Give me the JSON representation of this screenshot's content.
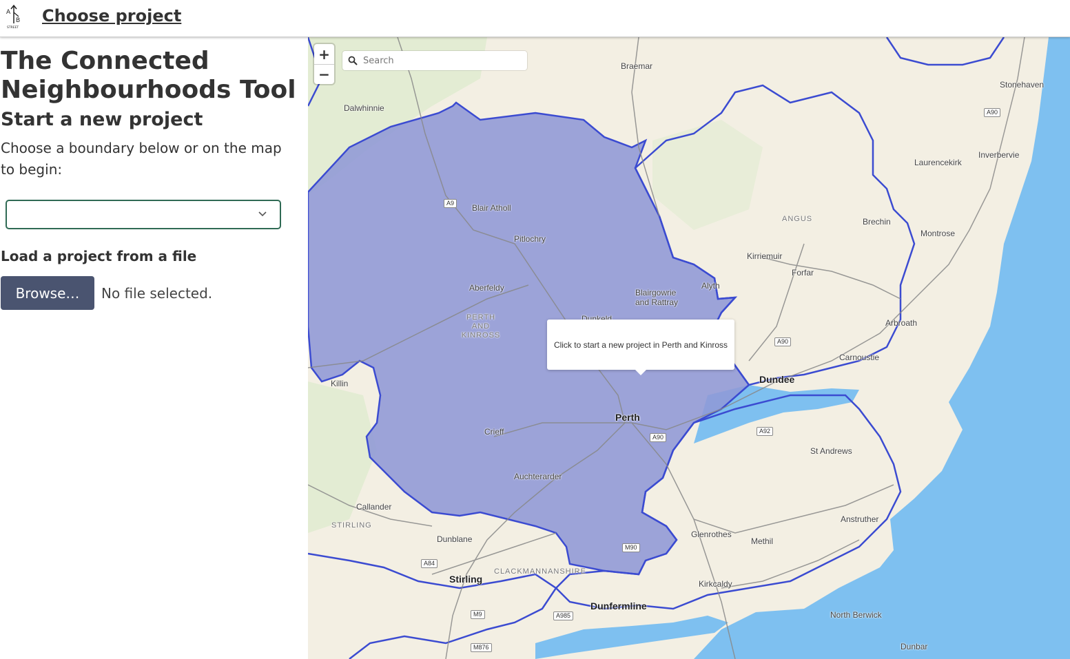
{
  "header": {
    "logo_alt": "A/B Street",
    "breadcrumb": "Choose project"
  },
  "sidebar": {
    "title": "The Connected Neighbourhoods Tool",
    "subtitle": "Start a new project",
    "instructions": "Choose a boundary below or on the map to begin:",
    "boundary_select": {
      "value": ""
    },
    "load_heading": "Load a project from a file",
    "browse_label": "Browse…",
    "file_status": "No file selected."
  },
  "map": {
    "zoom_in": "+",
    "zoom_out": "−",
    "search_placeholder": "Search",
    "popup_text": "Click to start a new project in Perth and Kinross",
    "colors": {
      "water": "#7ec0f0",
      "land": "#f3efe3",
      "boundary_fill": "#8f98d6",
      "boundary_line": "#3b4bd1",
      "popup_bg": "#ffffff"
    },
    "places": [
      "Braemar",
      "Dalwhinnie",
      "Stonehaven",
      "Laurencekirk",
      "Inverbervie",
      "Blair Atholl",
      "Pitlochry",
      "Brechin",
      "Montrose",
      "Kirriemuir",
      "Forfar",
      "Aberfeldy",
      "Blairgowrie and Rattray",
      "Alyth",
      "Arbroath",
      "Dunkeld",
      "Carnoustie",
      "Dundee",
      "Killin",
      "Perth",
      "Crieff",
      "St Andrews",
      "Auchterarder",
      "Callander",
      "Dunblane",
      "Glenrothes",
      "Methil",
      "Anstruther",
      "Stirling",
      "Dunfermline",
      "Kirkcaldy",
      "North Berwick",
      "Dunbar"
    ],
    "regions": [
      "ANGUS",
      "PERTH AND KINROSS",
      "STIRLING",
      "CLACKMANNANSHIRE"
    ],
    "roads": [
      "A9",
      "A90",
      "A92",
      "M90",
      "A84",
      "M9",
      "A985",
      "M876"
    ]
  }
}
